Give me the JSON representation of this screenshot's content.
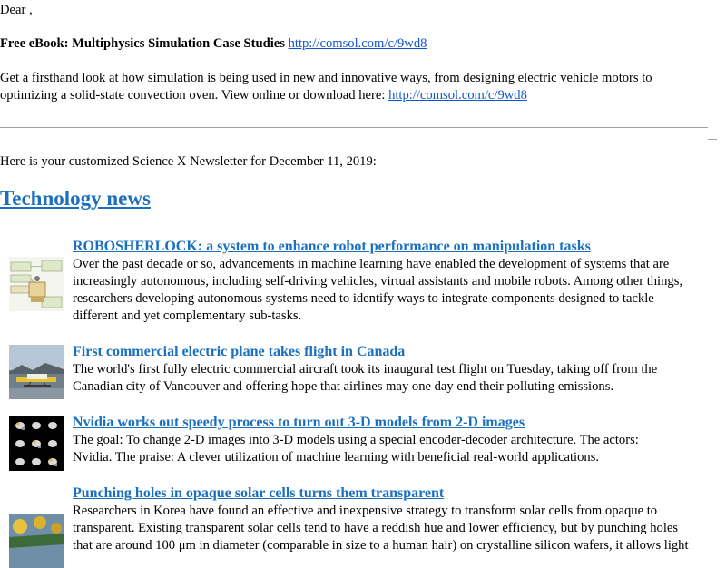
{
  "greeting": "Dear ,",
  "promo": {
    "title": "Free eBook: Multiphysics Simulation Case Studies",
    "title_link": "http://comsol.com/c/9wd8",
    "body_lines": [
      "Get a firsthand look at how simulation is being used in new and innovative ways, from designing electric vehicle motors to",
      "optimizing a solid-state convection oven. View online or download here:"
    ],
    "body_link": "http://comsol.com/c/9wd8"
  },
  "intro": "Here is your customized Science X Newsletter for December 11, 2019:",
  "section_title": "Technology news",
  "news": [
    {
      "title": "ROBOSHERLOCK: a system to enhance robot performance on manipulation tasks",
      "lines": [
        "Over the past decade or so, advancements in machine learning have enabled the development of systems that are",
        "increasingly autonomous, including self-driving vehicles, virtual assistants and mobile robots. Among other things,",
        "researchers developing autonomous systems need to identify ways to integrate components designed to tackle",
        "different and yet complementary sub-tasks."
      ],
      "thumb_icon": "robot-diagram-thumbnail"
    },
    {
      "title": "First commercial electric plane takes flight in Canada",
      "lines": [
        "The world's first fully electric commercial aircraft took its inaugural test flight on Tuesday, taking off from the",
        "Canadian city of Vancouver and offering hope that airlines may one day end their polluting emissions."
      ],
      "thumb_icon": "seaplane-thumbnail"
    },
    {
      "title": "Nvidia works out speedy process to turn out 3-D models from 2-D images",
      "lines": [
        "The goal: To change 2-D images into 3-D models using a special encoder-decoder architecture. The actors:",
        "Nvidia. The praise: A clever utilization of machine learning with beneficial real-world applications."
      ],
      "thumb_icon": "3d-models-thumbnail"
    },
    {
      "title": "Punching holes in opaque solar cells turns them transparent",
      "lines": [
        "Researchers in Korea have found an effective and inexpensive strategy to transform solar cells from opaque to",
        "transparent. Existing transparent solar cells tend to have a reddish hue and lower efficiency, but by punching holes",
        "that are around 100 μm in diameter (comparable in size to a human hair) on crystalline silicon wafers, it allows light"
      ],
      "thumb_icon": "solar-cell-thumbnail"
    }
  ]
}
